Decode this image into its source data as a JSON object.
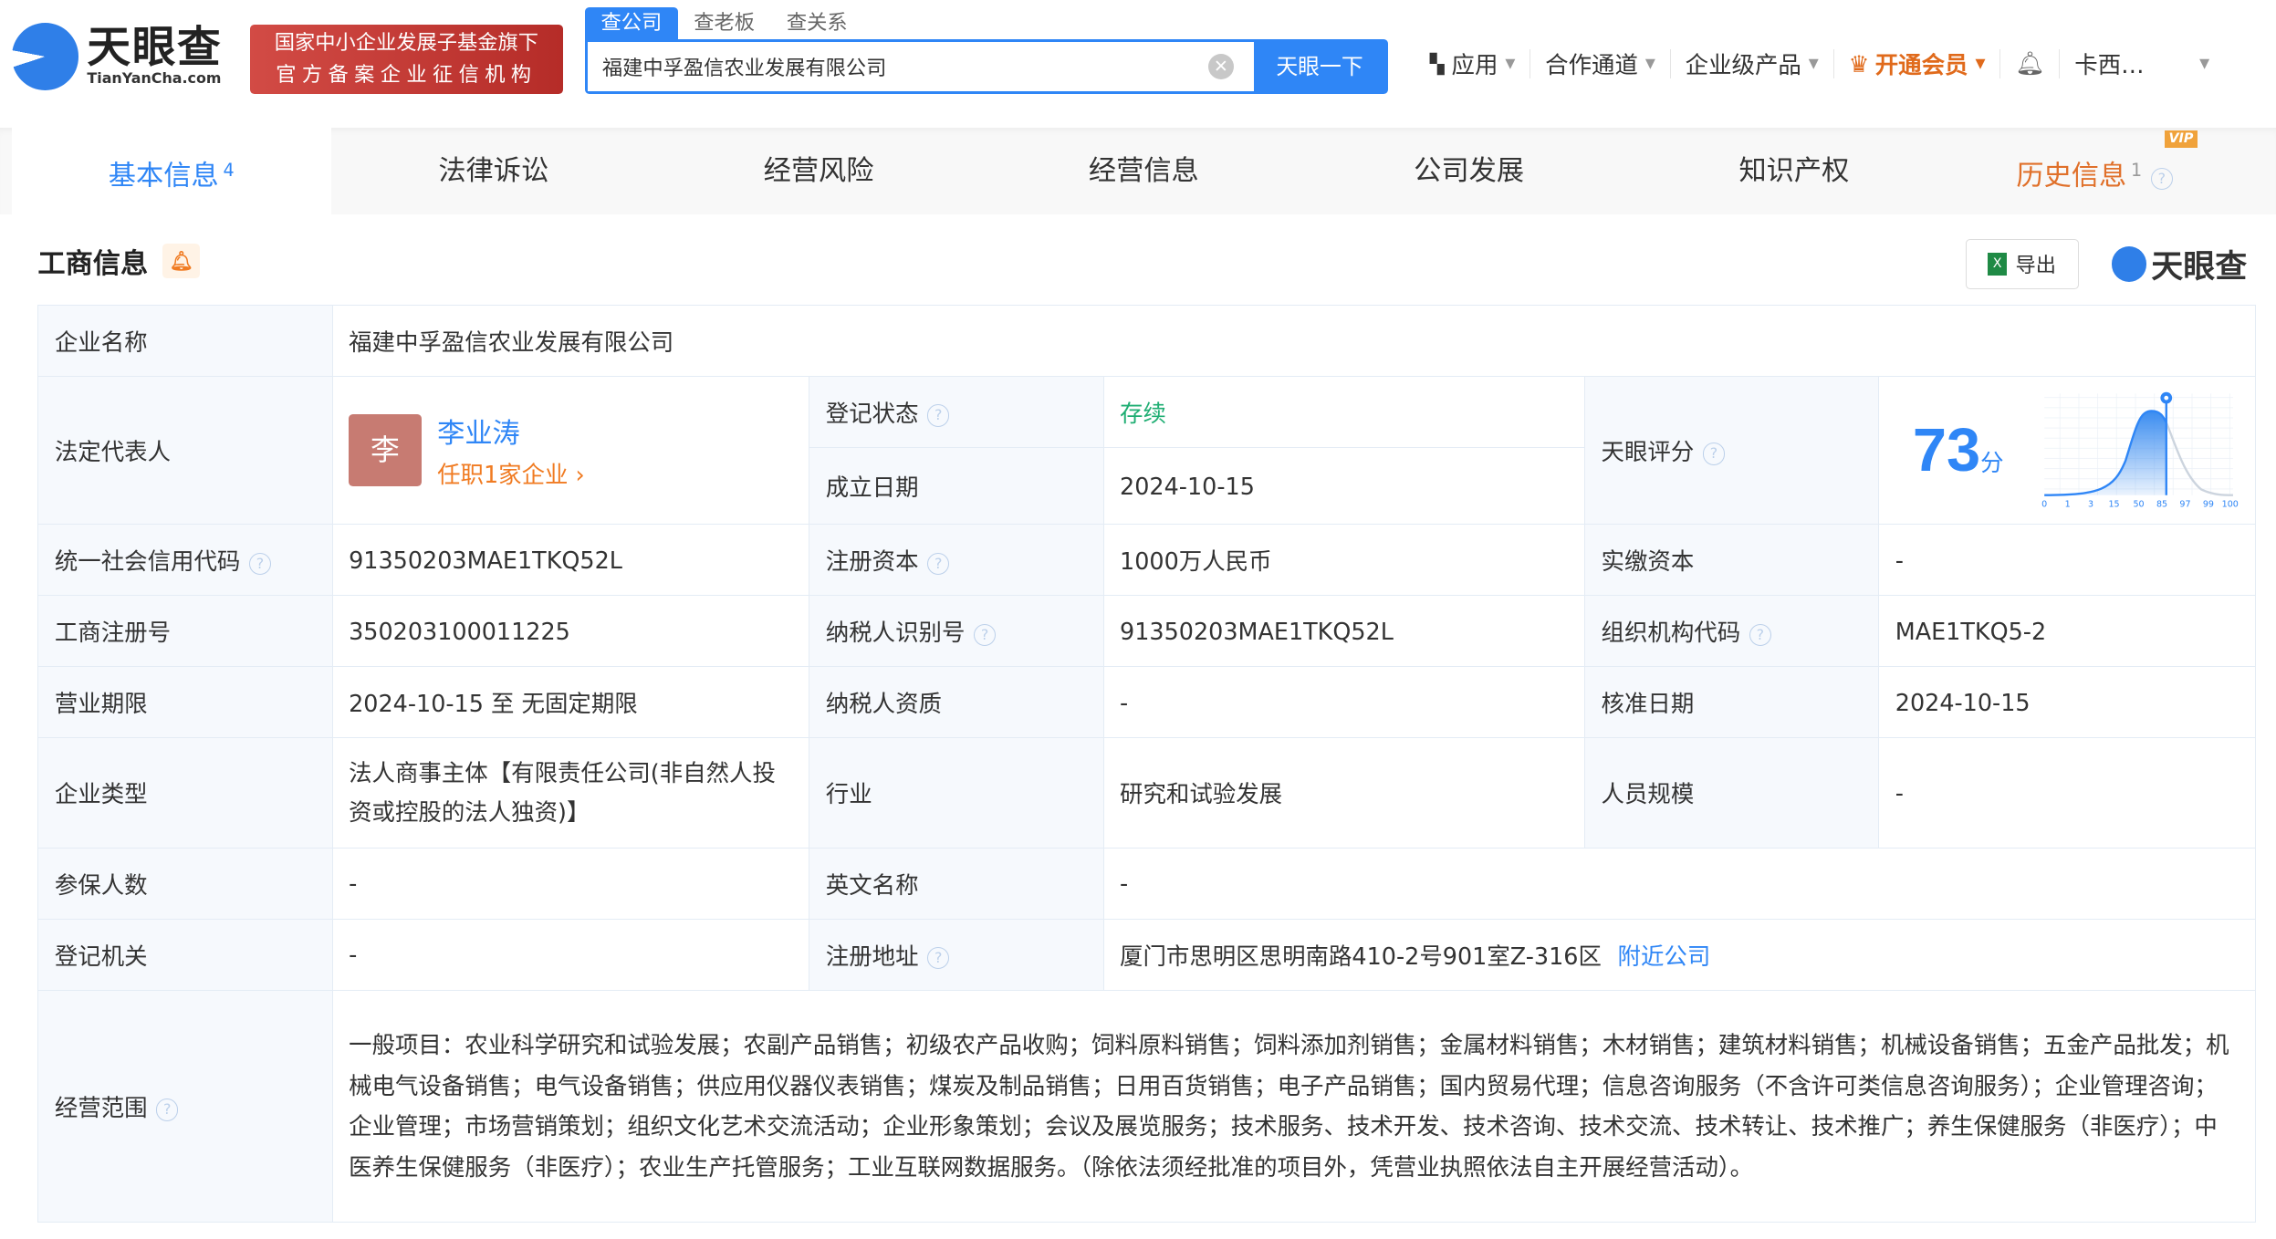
{
  "header": {
    "logo_cn": "天眼查",
    "logo_en": "TianYanCha.com",
    "badge_line1": "国家中小企业发展子基金旗下",
    "badge_line2": "官方备案企业征信机构",
    "search_tabs": [
      "查公司",
      "查老板",
      "查关系"
    ],
    "search_value": "福建中孚盈信农业发展有限公司",
    "search_button": "天眼一下",
    "nav": [
      "应用",
      "合作通道",
      "企业级产品",
      "开通会员",
      "卡西…"
    ]
  },
  "tabs": [
    {
      "label": "基本信息",
      "count": "4"
    },
    {
      "label": "法律诉讼"
    },
    {
      "label": "经营风险"
    },
    {
      "label": "经营信息"
    },
    {
      "label": "公司发展"
    },
    {
      "label": "知识产权"
    },
    {
      "label": "历史信息",
      "count": "1",
      "tag": "VIP"
    }
  ],
  "section": {
    "title": "工商信息",
    "export": "导出",
    "logo": "天眼查"
  },
  "info": {
    "name_label": "企业名称",
    "name": "福建中孚盈信农业发展有限公司",
    "legal_label": "法定代表人",
    "legal_avatar": "李",
    "legal_name": "李业涛",
    "legal_sub": "任职1家企业 ›",
    "status_label": "登记状态",
    "status": "存续",
    "found_label": "成立日期",
    "found": "2024-10-15",
    "score_label": "天眼评分",
    "score": "73",
    "score_unit": "分",
    "score_ticks": [
      "0",
      "1",
      "3",
      "15",
      "50",
      "85",
      "97",
      "99",
      "100"
    ],
    "credit_label": "统一社会信用代码",
    "credit": "91350203MAE1TKQ52L",
    "capital_label": "注册资本",
    "capital": "1000万人民币",
    "paid_label": "实缴资本",
    "paid": "-",
    "reg_label": "工商注册号",
    "reg": "350203100011225",
    "tax_label": "纳税人识别号",
    "tax": "91350203MAE1TKQ52L",
    "org_label": "组织机构代码",
    "org": "MAE1TKQ5-2",
    "term_label": "营业期限",
    "term": "2024-10-15 至 无固定期限",
    "taxq_label": "纳税人资质",
    "taxq": "-",
    "approve_label": "核准日期",
    "approve": "2024-10-15",
    "type_label": "企业类型",
    "type": "法人商事主体【有限责任公司(非自然人投资或控股的法人独资)】",
    "industry_label": "行业",
    "industry": "研究和试验发展",
    "staff_label": "人员规模",
    "staff": "-",
    "insured_label": "参保人数",
    "insured": "-",
    "en_label": "英文名称",
    "en": "-",
    "authority_label": "登记机关",
    "authority": "-",
    "addr_label": "注册地址",
    "addr": "厦门市思明区思明南路410-2号901室Z-316区",
    "nearby": "附近公司",
    "scope_label": "经营范围",
    "scope": "一般项目：农业科学研究和试验发展；农副产品销售；初级农产品收购；饲料原料销售；饲料添加剂销售；金属材料销售；木材销售；建筑材料销售；机械设备销售；五金产品批发；机械电气设备销售；电气设备销售；供应用仪器仪表销售；煤炭及制品销售；日用百货销售；电子产品销售；国内贸易代理；信息咨询服务（不含许可类信息咨询服务）；企业管理咨询；企业管理；市场营销策划；组织文化艺术交流活动；企业形象策划；会议及展览服务；技术服务、技术开发、技术咨询、技术交流、技术转让、技术推广；养生保健服务（非医疗）；中医养生保健服务（非医疗）；农业生产托管服务；工业互联网数据服务。（除依法须经批准的项目外，凭营业执照依法自主开展经营活动）。"
  }
}
